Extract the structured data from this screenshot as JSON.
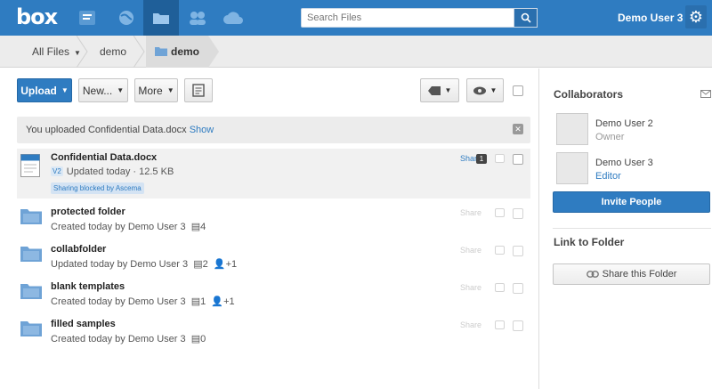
{
  "app": {
    "logo": "box",
    "username": "Demo User 3"
  },
  "topnav": {
    "icons": [
      "updates-icon",
      "globe-icon",
      "folder-icon",
      "people-icon",
      "cloud-icon"
    ],
    "search_placeholder": "Search Files"
  },
  "breadcrumb": {
    "items": [
      "All Files",
      "demo",
      "demo"
    ]
  },
  "toolbar": {
    "upload": "Upload",
    "new": "New...",
    "more": "More"
  },
  "notice": {
    "text": "You uploaded Confidential Data.docx",
    "action": "Show"
  },
  "files": [
    {
      "name": "Confidential Data.docx",
      "version": "V2",
      "meta": "Updated today",
      "size": "12.5 KB",
      "badge": "Sharing blocked by Ascema",
      "share": "Share",
      "comments": "1",
      "type": "docx"
    },
    {
      "name": "protected folder",
      "meta": "Created today by Demo User 3",
      "files": "4",
      "collabs": "",
      "share": "Share",
      "type": "folder"
    },
    {
      "name": "collabfolder",
      "meta": "Updated today by Demo User 3",
      "files": "2",
      "collabs": "+1",
      "share": "Share",
      "type": "folder"
    },
    {
      "name": "blank templates",
      "meta": "Created today by Demo User 3",
      "files": "1",
      "collabs": "+1",
      "share": "Share",
      "type": "folder"
    },
    {
      "name": "filled samples",
      "meta": "Created today by Demo User 3",
      "files": "0",
      "collabs": "",
      "share": "Share",
      "type": "folder"
    }
  ],
  "sidebar": {
    "collaborators_title": "Collaborators",
    "collaborators": [
      {
        "name": "Demo User 2",
        "role": "Owner"
      },
      {
        "name": "Demo User 3",
        "role": "Editor"
      }
    ],
    "invite": "Invite People",
    "link_title": "Link to Folder",
    "share_folder": "Share this Folder"
  },
  "colors": {
    "brand": "#2f7cc1",
    "brand_dark": "#1f5f99"
  }
}
